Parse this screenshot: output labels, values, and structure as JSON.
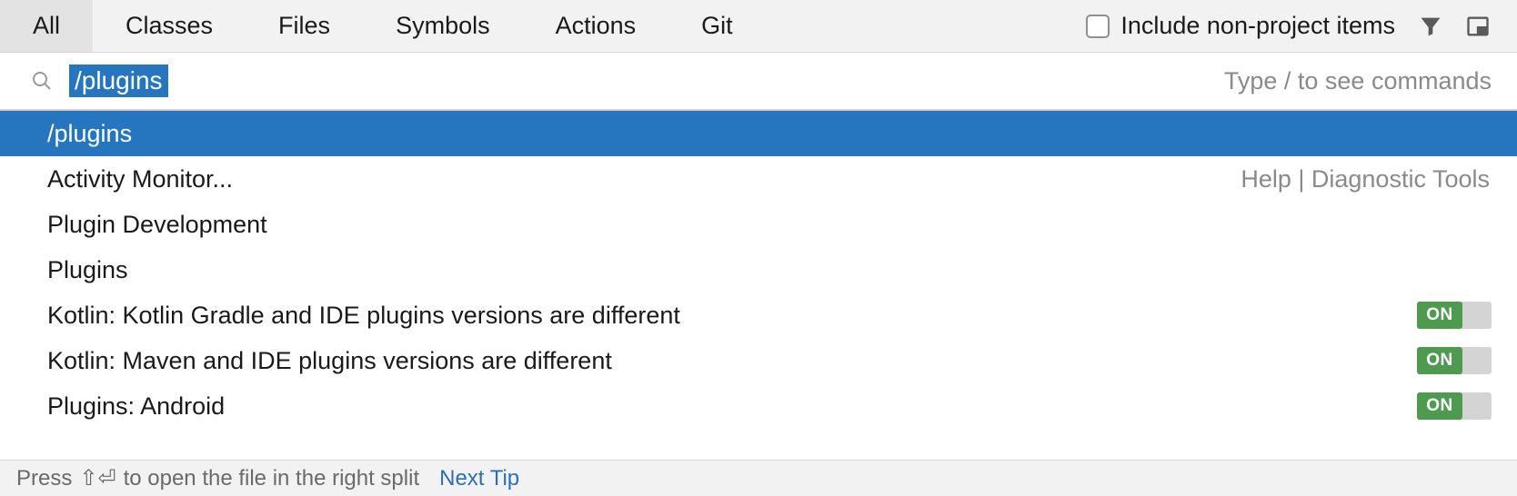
{
  "tabs": {
    "items": [
      {
        "label": "All",
        "active": true
      },
      {
        "label": "Classes",
        "active": false
      },
      {
        "label": "Files",
        "active": false
      },
      {
        "label": "Symbols",
        "active": false
      },
      {
        "label": "Actions",
        "active": false
      },
      {
        "label": "Git",
        "active": false
      }
    ],
    "include_label": "Include non-project items"
  },
  "search": {
    "query": "/plugins",
    "hint": "Type / to see commands"
  },
  "results": [
    {
      "label": "/plugins",
      "selected": true,
      "right": "",
      "toggle": null
    },
    {
      "label": "Activity Monitor...",
      "selected": false,
      "right": "Help | Diagnostic Tools",
      "toggle": null
    },
    {
      "label": "Plugin Development",
      "selected": false,
      "right": "",
      "toggle": null
    },
    {
      "label": "Plugins",
      "selected": false,
      "right": "",
      "toggle": null
    },
    {
      "label": "Kotlin: Kotlin Gradle and IDE plugins versions are different",
      "selected": false,
      "right": "",
      "toggle": "ON"
    },
    {
      "label": "Kotlin: Maven and IDE plugins versions are different",
      "selected": false,
      "right": "",
      "toggle": "ON"
    },
    {
      "label": "Plugins: Android",
      "selected": false,
      "right": "",
      "toggle": "ON"
    }
  ],
  "footer": {
    "text_before": "Press ",
    "keys": "⇧⏎",
    "text_after": " to open the file in the right split",
    "link": "Next Tip"
  }
}
